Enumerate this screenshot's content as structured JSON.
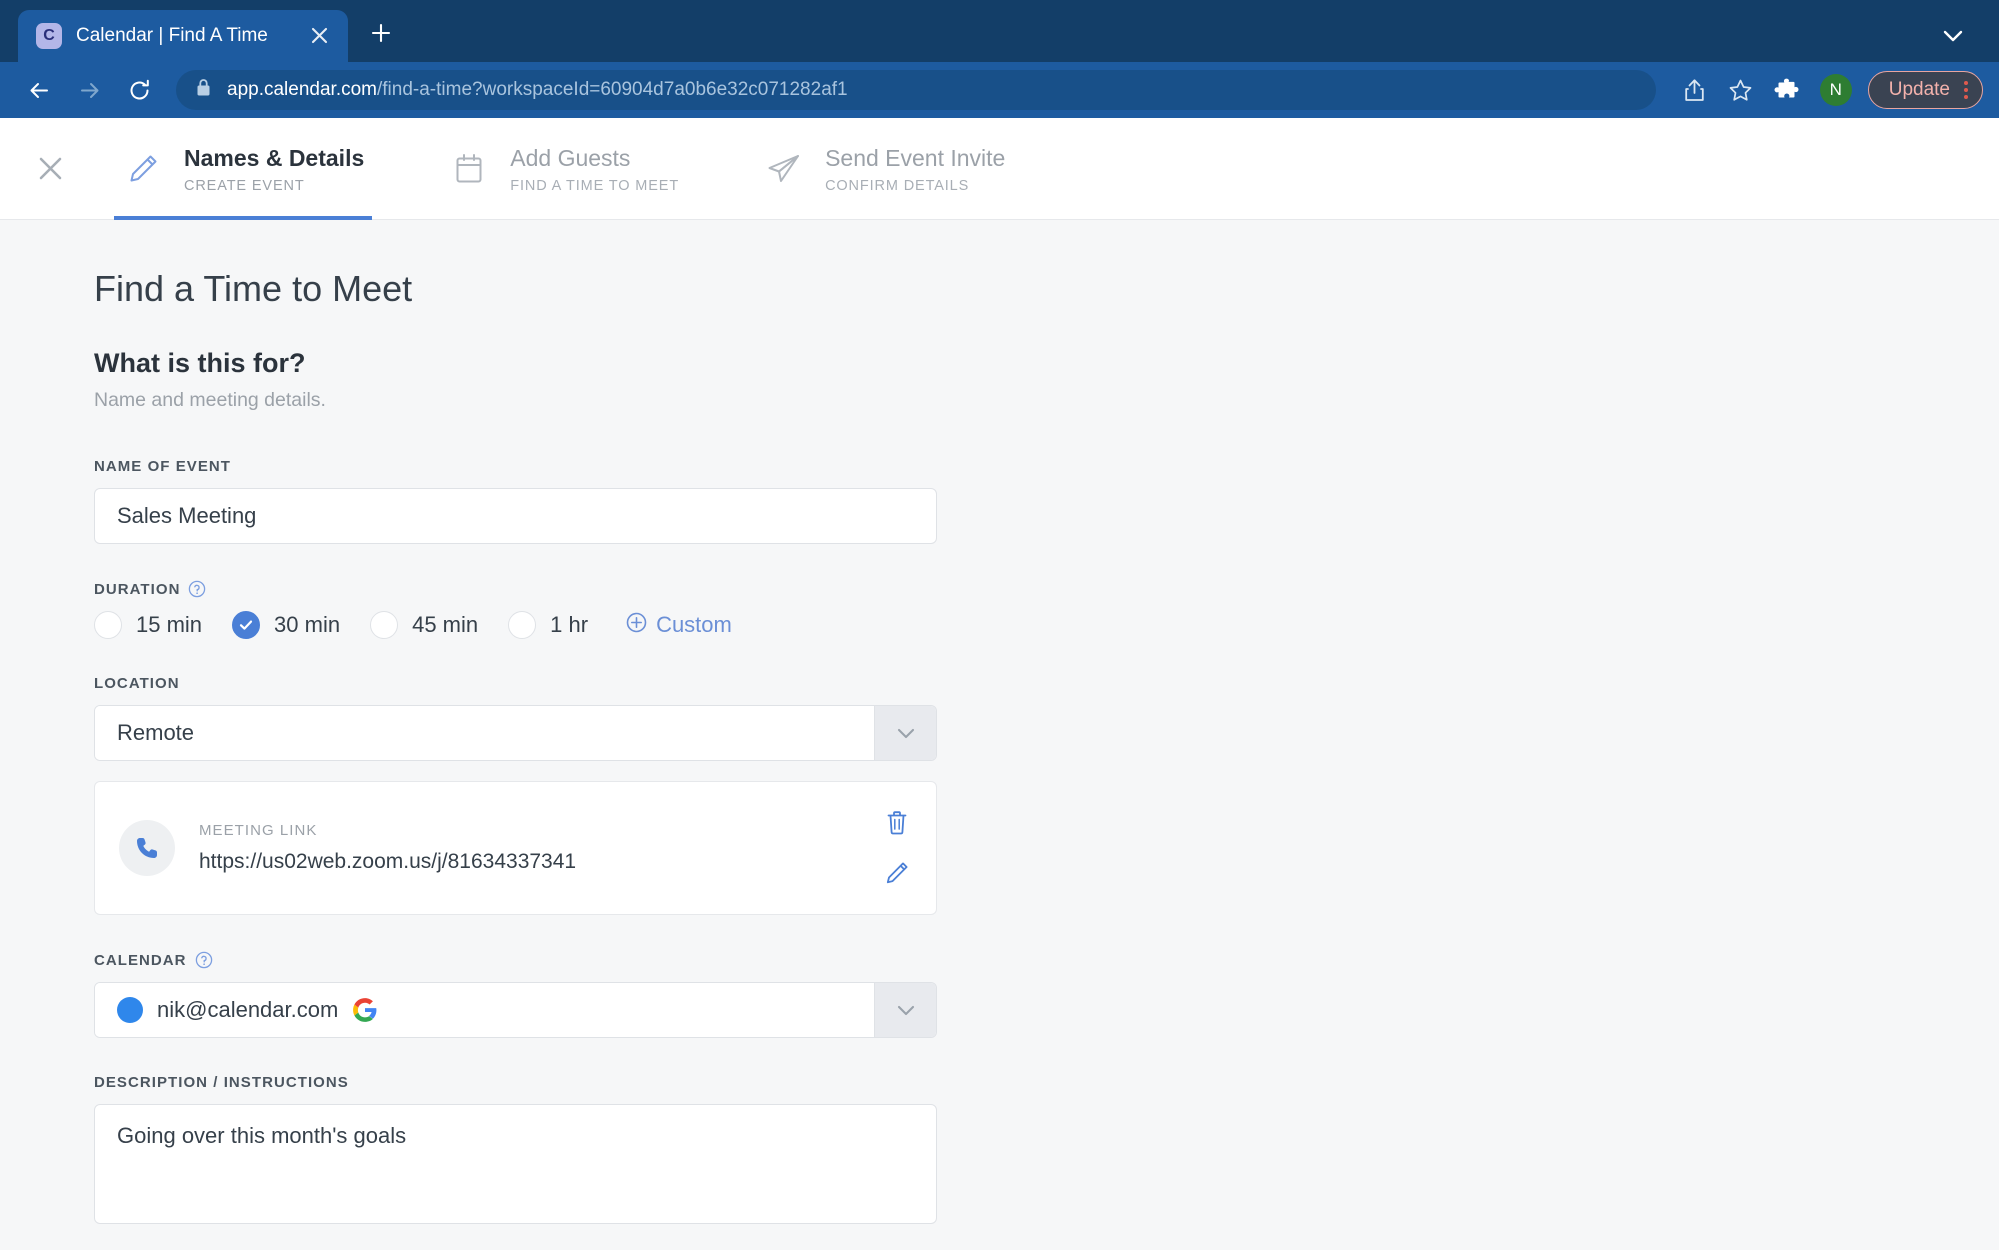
{
  "browser": {
    "tab": {
      "favicon_letter": "C",
      "title": "Calendar | Find A Time",
      "close_icon": "close-icon"
    },
    "new_tab_label": "+",
    "url": {
      "domain": "app.calendar.com",
      "path": "/find-a-time?workspaceId=60904d7a0b6e32c071282af1",
      "lock_icon": "lock-icon"
    },
    "actions": {
      "back_icon": "back-arrow-icon",
      "forward_icon": "forward-arrow-icon",
      "reload_icon": "reload-icon",
      "share_icon": "share-icon",
      "bookmark_icon": "star-icon",
      "extensions_icon": "puzzle-icon",
      "profile_initial": "N",
      "update_label": "Update",
      "menu_icon": "kebab-menu-icon",
      "tablist_chevron_icon": "chevron-down-icon"
    },
    "colors": {
      "tabstrip_bg": "#133e68",
      "toolbar_bg": "#1d5ba0",
      "active_tab_bg": "#1d5ba0",
      "profile_green": "#2e7d32",
      "update_text": "#f3b2ac"
    }
  },
  "stepbar": {
    "close_label": "×",
    "steps": [
      {
        "title": "Names & Details",
        "sub": "CREATE EVENT",
        "icon": "pencil-icon",
        "active": true
      },
      {
        "title": "Add Guests",
        "sub": "FIND A TIME TO MEET",
        "icon": "calendar-icon",
        "active": false
      },
      {
        "title": "Send Event Invite",
        "sub": "CONFIRM DETAILS",
        "icon": "paper-plane-icon",
        "active": false
      }
    ],
    "accent": "#4a7fd6"
  },
  "main": {
    "page_title": "Find a Time to Meet",
    "section_heading": "What is this for?",
    "section_sub": "Name and meeting details.",
    "name_of_event": {
      "label": "NAME OF EVENT",
      "value": "Sales Meeting"
    },
    "duration": {
      "label": "DURATION",
      "help_icon": "help-circle-icon",
      "options": [
        {
          "label": "15 min",
          "selected": false
        },
        {
          "label": "30 min",
          "selected": true
        },
        {
          "label": "45 min",
          "selected": false
        },
        {
          "label": "1 hr",
          "selected": false
        }
      ],
      "custom_label": "Custom",
      "custom_icon": "plus-circle-icon"
    },
    "location": {
      "label": "LOCATION",
      "value": "Remote",
      "chevron_icon": "chevron-down-icon"
    },
    "meeting_link": {
      "icon": "phone-icon",
      "label": "MEETING LINK",
      "url": "https://us02web.zoom.us/j/81634337341",
      "delete_icon": "trash-icon",
      "edit_icon": "pencil-icon"
    },
    "calendar": {
      "label": "CALENDAR",
      "help_icon": "help-circle-icon",
      "value": "nik@calendar.com",
      "provider_icon": "google-g-icon",
      "dot_color": "#2f87eb",
      "chevron_icon": "chevron-down-icon"
    },
    "description": {
      "label": "DESCRIPTION / INSTRUCTIONS",
      "value": "Going over this month's goals"
    }
  }
}
